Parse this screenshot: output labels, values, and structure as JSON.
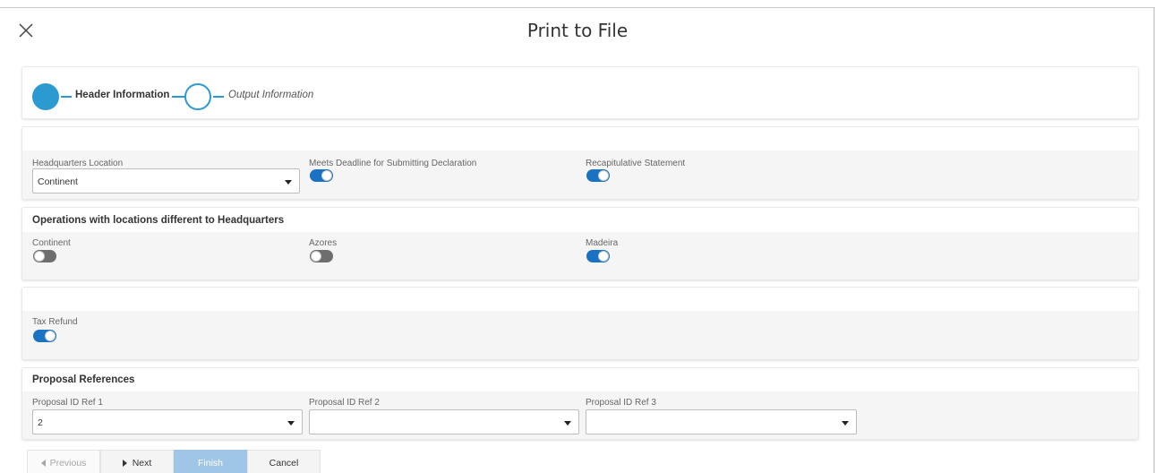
{
  "dialog": {
    "title": "Print to File"
  },
  "wizard": {
    "steps": [
      {
        "label": "Header Information",
        "state": "active"
      },
      {
        "label": "Output Information",
        "state": "inactive"
      }
    ]
  },
  "header_section": {
    "headquarters_location": {
      "label": "Headquarters Location",
      "value": "Continent"
    },
    "meets_deadline": {
      "label": "Meets Deadline for Submitting Declaration",
      "on": true
    },
    "recapitulative_statement": {
      "label": "Recapitulative Statement",
      "on": true
    }
  },
  "operations_section": {
    "title": "Operations with locations different to Headquarters",
    "continent": {
      "label": "Continent",
      "on": false
    },
    "azores": {
      "label": "Azores",
      "on": false
    },
    "madeira": {
      "label": "Madeira",
      "on": true
    }
  },
  "tax_section": {
    "tax_refund": {
      "label": "Tax Refund",
      "on": true
    }
  },
  "proposal_section": {
    "title": "Proposal References",
    "ref1": {
      "label": "Proposal ID Ref 1",
      "value": "2"
    },
    "ref2": {
      "label": "Proposal ID Ref 2",
      "value": ""
    },
    "ref3": {
      "label": "Proposal ID Ref 3",
      "value": ""
    }
  },
  "footer": {
    "previous_label": "Previous",
    "next_label": "Next",
    "finish_label": "Finish",
    "cancel_label": "Cancel"
  },
  "colors": {
    "accent": "#2b9ad0",
    "toggle_on": "#1a73c2",
    "toggle_off": "#6e6e6e",
    "finish_button": "#9fc6e6"
  },
  "icons": {
    "close": "close-icon",
    "dropdown": "chevron-down-icon",
    "previous": "caret-left-icon",
    "next": "caret-right-icon"
  }
}
